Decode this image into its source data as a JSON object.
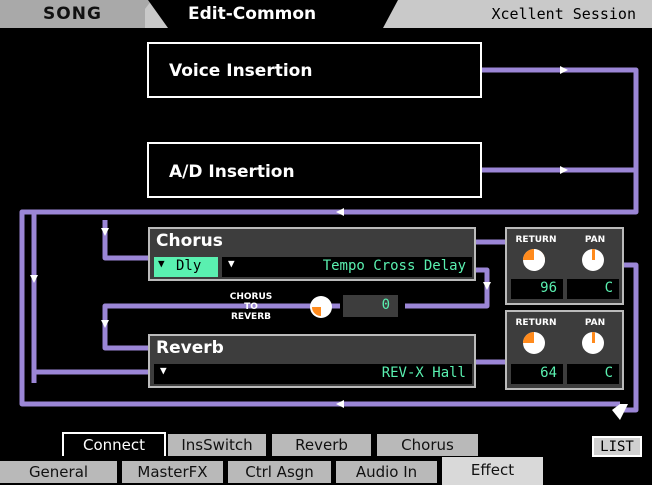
{
  "header": {
    "mode": "SONG",
    "screen": "Edit-Common",
    "song_name": "Xcellent Session"
  },
  "blocks": {
    "voice_insertion": "Voice Insertion",
    "ad_insertion": "A/D Insertion"
  },
  "chorus": {
    "title": "Chorus",
    "category": "Dly",
    "type": "Tempo Cross Delay",
    "to_reverb_label_line1": "CHORUS TO",
    "to_reverb_label_line2": "REVERB",
    "to_reverb_value": "0",
    "return_label": "RETURN",
    "pan_label": "PAN",
    "return_value": "96",
    "pan_value": "C"
  },
  "reverb": {
    "title": "Reverb",
    "type": "REV-X Hall",
    "return_label": "RETURN",
    "pan_label": "PAN",
    "return_value": "64",
    "pan_value": "C"
  },
  "sub_tabs": [
    "Connect",
    "InsSwitch",
    "Reverb",
    "Chorus"
  ],
  "sub_tab_active": "Connect",
  "list_button": "LIST",
  "main_tabs": [
    "General",
    "MasterFX",
    "Ctrl Asgn",
    "Audio In",
    "Effect"
  ],
  "main_tab_active": "Effect",
  "colors": {
    "wire": "#9b86d6",
    "value_text": "#5af0b0",
    "knob_accent": "#ff8a1c"
  }
}
